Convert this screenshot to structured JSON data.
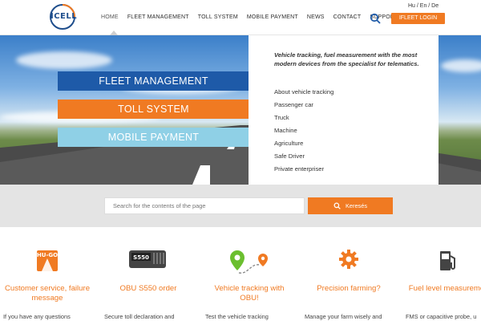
{
  "header": {
    "logo_text": "ICELL",
    "nav": [
      "HOME",
      "FLEET MANAGEMENT",
      "TOLL SYSTEM",
      "MOBILE PAYMENT",
      "NEWS",
      "CONTACT",
      "SUPPORT"
    ],
    "languages": "Hu  /  En  /  De",
    "login_label": "IFLEET LOGIN"
  },
  "hero": {
    "bands": {
      "fleet": "FLEET MANAGEMENT",
      "toll": "TOLL SYSTEM",
      "mobile": "MOBILE PAYMENT"
    },
    "intro": "Vehicle tracking, fuel measurement with the most modern devices from the specialist for telematics.",
    "links": [
      "About vehicle tracking",
      "Passenger car",
      "Truck",
      "Machine",
      "Agriculture",
      "Safe Driver",
      "Private enterpriser"
    ]
  },
  "search": {
    "placeholder": "Search for the contents of the page",
    "button_label": "Keresés"
  },
  "features": [
    {
      "title": "Customer service, failure message",
      "text": "If you have any questions",
      "badge": "HU-GO"
    },
    {
      "title": "OBU S550 order",
      "text": "Secure toll declaration and",
      "badge": "S550"
    },
    {
      "title": "Vehicle tracking with OBU!",
      "text": "Test the vehicle tracking"
    },
    {
      "title": "Precision farming?",
      "text": "Manage your farm wisely and"
    },
    {
      "title": "Fuel level measurement",
      "text": "FMS or capacitive probe, u"
    }
  ],
  "colors": {
    "orange": "#f07a22",
    "blue": "#1e5aa8",
    "light_blue": "#8fd0e6",
    "green": "#6bbf2f"
  }
}
